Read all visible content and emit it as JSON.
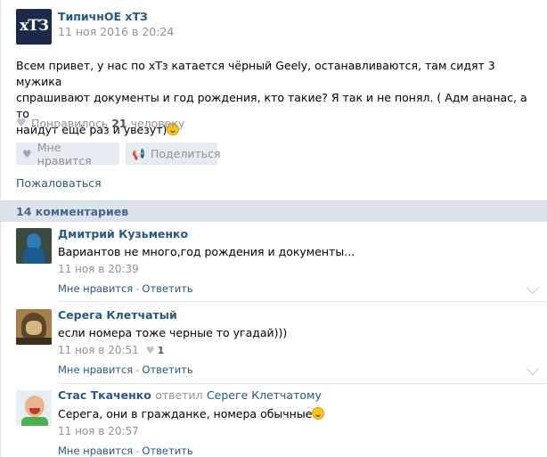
{
  "post": {
    "author": "ТипичнОЕ хТЗ",
    "avatar_text": "хТЗ",
    "date": "11 ноя 2016 в 20:24",
    "text_lines": [
      "Всем привет, у нас по хТз катается чёрный Geely, останавливаются, там сидят 3 мужика",
      "спрашивают документы и год рождения, кто такие? Я так и не понял. ( Адм ананас, а то",
      "найдут ещё раз и увезут)"
    ],
    "likes_prefix": "Понравилось",
    "likes_count": "21",
    "likes_suffix": "человеку",
    "like_button": "Мне нравится",
    "share_button": "Поделиться",
    "complain_link": "Пожаловаться"
  },
  "comments_header": "14 комментариев",
  "comments": [
    {
      "author": "Дмитрий Кузьменко",
      "text": "Вариантов не много,год рождения и документы...",
      "date": "11 ноя в 20:39",
      "likes": "",
      "like_link": "Мне нравится",
      "reply_link": "Ответить"
    },
    {
      "author": "Серега Клетчатый",
      "text": "если номера тоже черные то угадай)))",
      "date": "11 ноя в 20:51",
      "likes": "1",
      "like_link": "Мне нравится",
      "reply_link": "Ответить"
    },
    {
      "author": "Стас Ткаченко",
      "reply_verb": "ответил",
      "reply_to": "Сереге Клетчатому",
      "text": "Серега, они в гражданке, номера обычные",
      "date": "11 ноя в 20:57",
      "likes": "",
      "like_link": "Мне нравится",
      "reply_link": "Ответить"
    }
  ],
  "separator": "-",
  "icons": [
    "heart-icon",
    "megaphone-icon",
    "smile-emoji-icon",
    "chevron-down-icon"
  ]
}
